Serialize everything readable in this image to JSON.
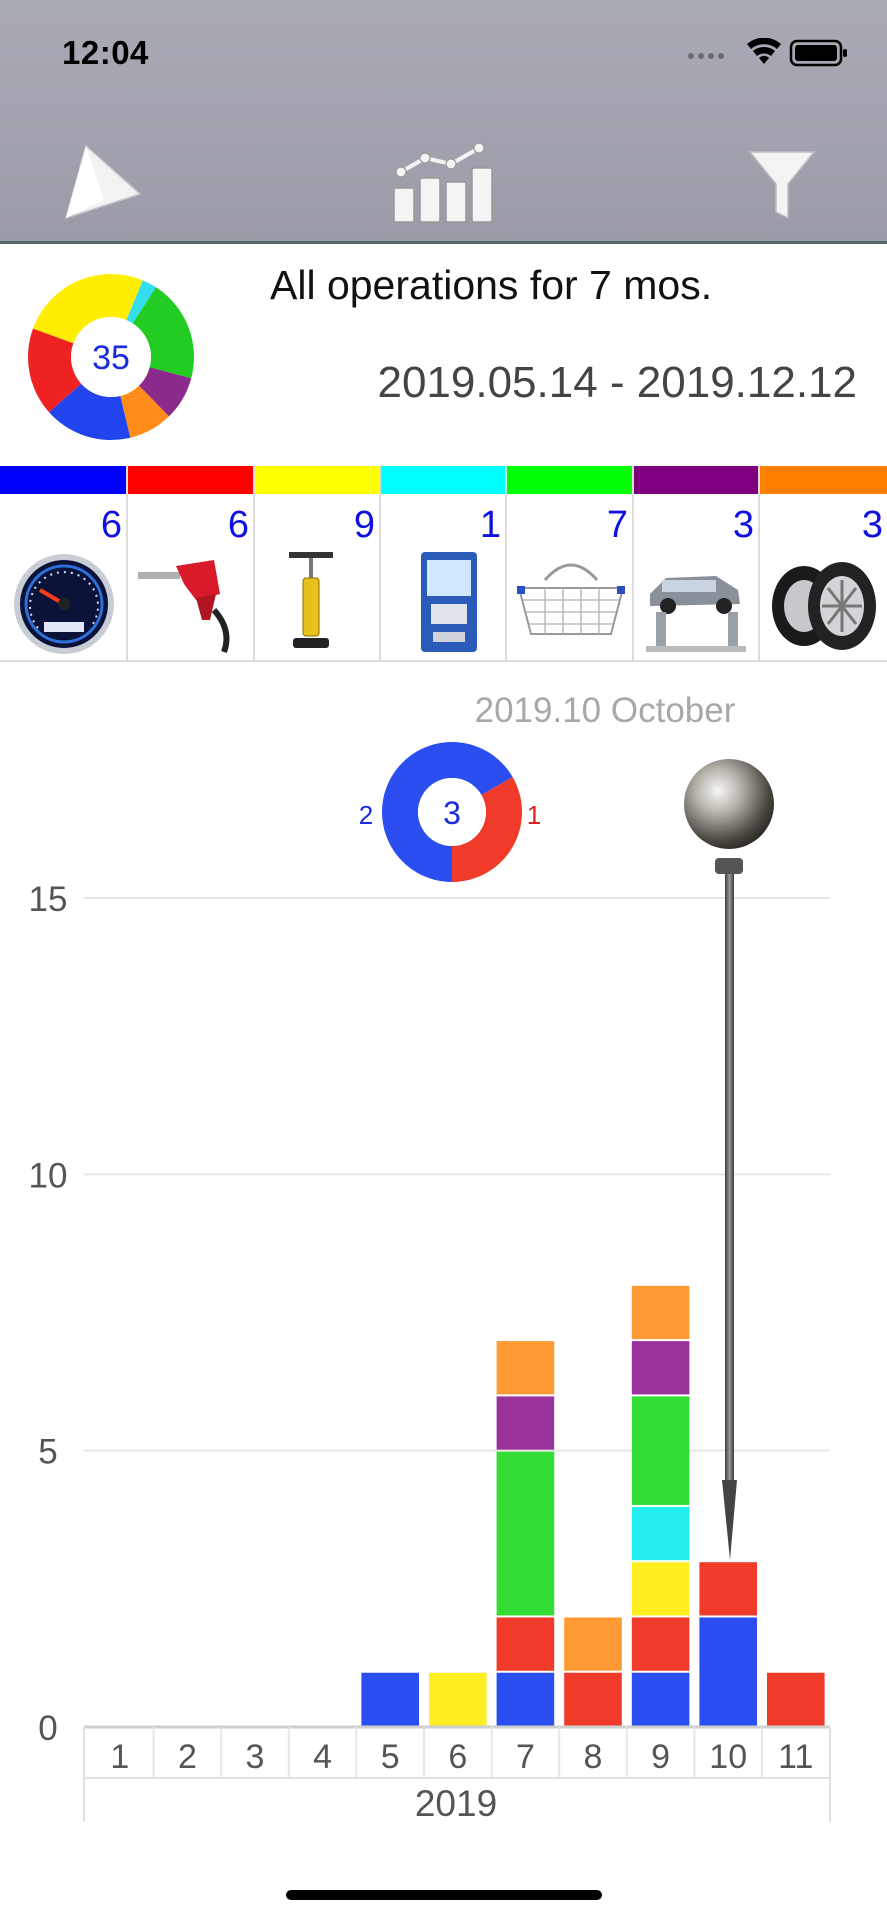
{
  "status_bar": {
    "time": "12:04"
  },
  "toolbar": {
    "back": "back-arrow-icon",
    "stats": "chart-statistics-icon",
    "filter": "filter-icon"
  },
  "summary": {
    "total": "35",
    "title": "All operations for 7 mos.",
    "date_range": "2019.05.14 - 2019.12.12",
    "donut_colors": [
      "#ffee00",
      "#33ddee",
      "#22cc22",
      "#8a2a8a",
      "#ff8c1a",
      "#2244ee",
      "#ee2222"
    ],
    "donut_values": [
      9,
      1,
      7,
      3,
      3,
      6,
      6
    ]
  },
  "categories": [
    {
      "name": "odometer",
      "icon": "speedometer-icon",
      "count": "6",
      "color": "#0000ff"
    },
    {
      "name": "fuel",
      "icon": "fuel-nozzle-icon",
      "count": "6",
      "color": "#ff0000"
    },
    {
      "name": "tire-pump",
      "icon": "air-pump-icon",
      "count": "9",
      "color": "#ffff00"
    },
    {
      "name": "payment-terminal",
      "icon": "payment-terminal-icon",
      "count": "1",
      "color": "#00ffff"
    },
    {
      "name": "shopping",
      "icon": "shopping-basket-icon",
      "count": "7",
      "color": "#00ff00"
    },
    {
      "name": "car-service",
      "icon": "car-lift-icon",
      "count": "3",
      "color": "#800080"
    },
    {
      "name": "tires",
      "icon": "tires-icon",
      "count": "3",
      "color": "#ff8000"
    }
  ],
  "chart_data": {
    "type": "bar",
    "stacked": true,
    "title": "",
    "year_label": "2019",
    "categories": [
      "1",
      "2",
      "3",
      "4",
      "5",
      "6",
      "7",
      "8",
      "9",
      "10",
      "11"
    ],
    "ylim": [
      0,
      15
    ],
    "yticks": [
      0,
      5,
      10,
      15
    ],
    "grid": true,
    "series": [
      {
        "name": "",
        "color": "#2a4ef0",
        "values": [
          0,
          0,
          0,
          0,
          1,
          0,
          1,
          0,
          1,
          2,
          0
        ]
      },
      {
        "name": "",
        "color": "#f03a2a",
        "values": [
          0,
          0,
          0,
          0,
          0,
          0,
          1,
          1,
          1,
          1,
          1
        ]
      },
      {
        "name": "",
        "color": "#ffee22",
        "values": [
          0,
          0,
          0,
          0,
          0,
          1,
          0,
          0,
          1,
          0,
          0
        ]
      },
      {
        "name": "",
        "color": "#22eeee",
        "values": [
          0,
          0,
          0,
          0,
          0,
          0,
          0,
          0,
          1,
          0,
          0
        ]
      },
      {
        "name": "",
        "color": "#33dd33",
        "values": [
          0,
          0,
          0,
          0,
          0,
          0,
          3,
          0,
          2,
          0,
          0
        ]
      },
      {
        "name": "",
        "color": "#993399",
        "values": [
          0,
          0,
          0,
          0,
          0,
          0,
          1,
          0,
          1,
          0,
          0
        ]
      },
      {
        "name": "",
        "color": "#ff9933",
        "values": [
          0,
          0,
          0,
          0,
          0,
          0,
          1,
          1,
          1,
          0,
          0
        ]
      }
    ],
    "selected": {
      "label": "2019.10 October",
      "month_index": 9,
      "total": "3",
      "parts": [
        {
          "value": "2",
          "color": "#2a4ef0"
        },
        {
          "value": "1",
          "color": "#f03a2a"
        }
      ]
    }
  }
}
